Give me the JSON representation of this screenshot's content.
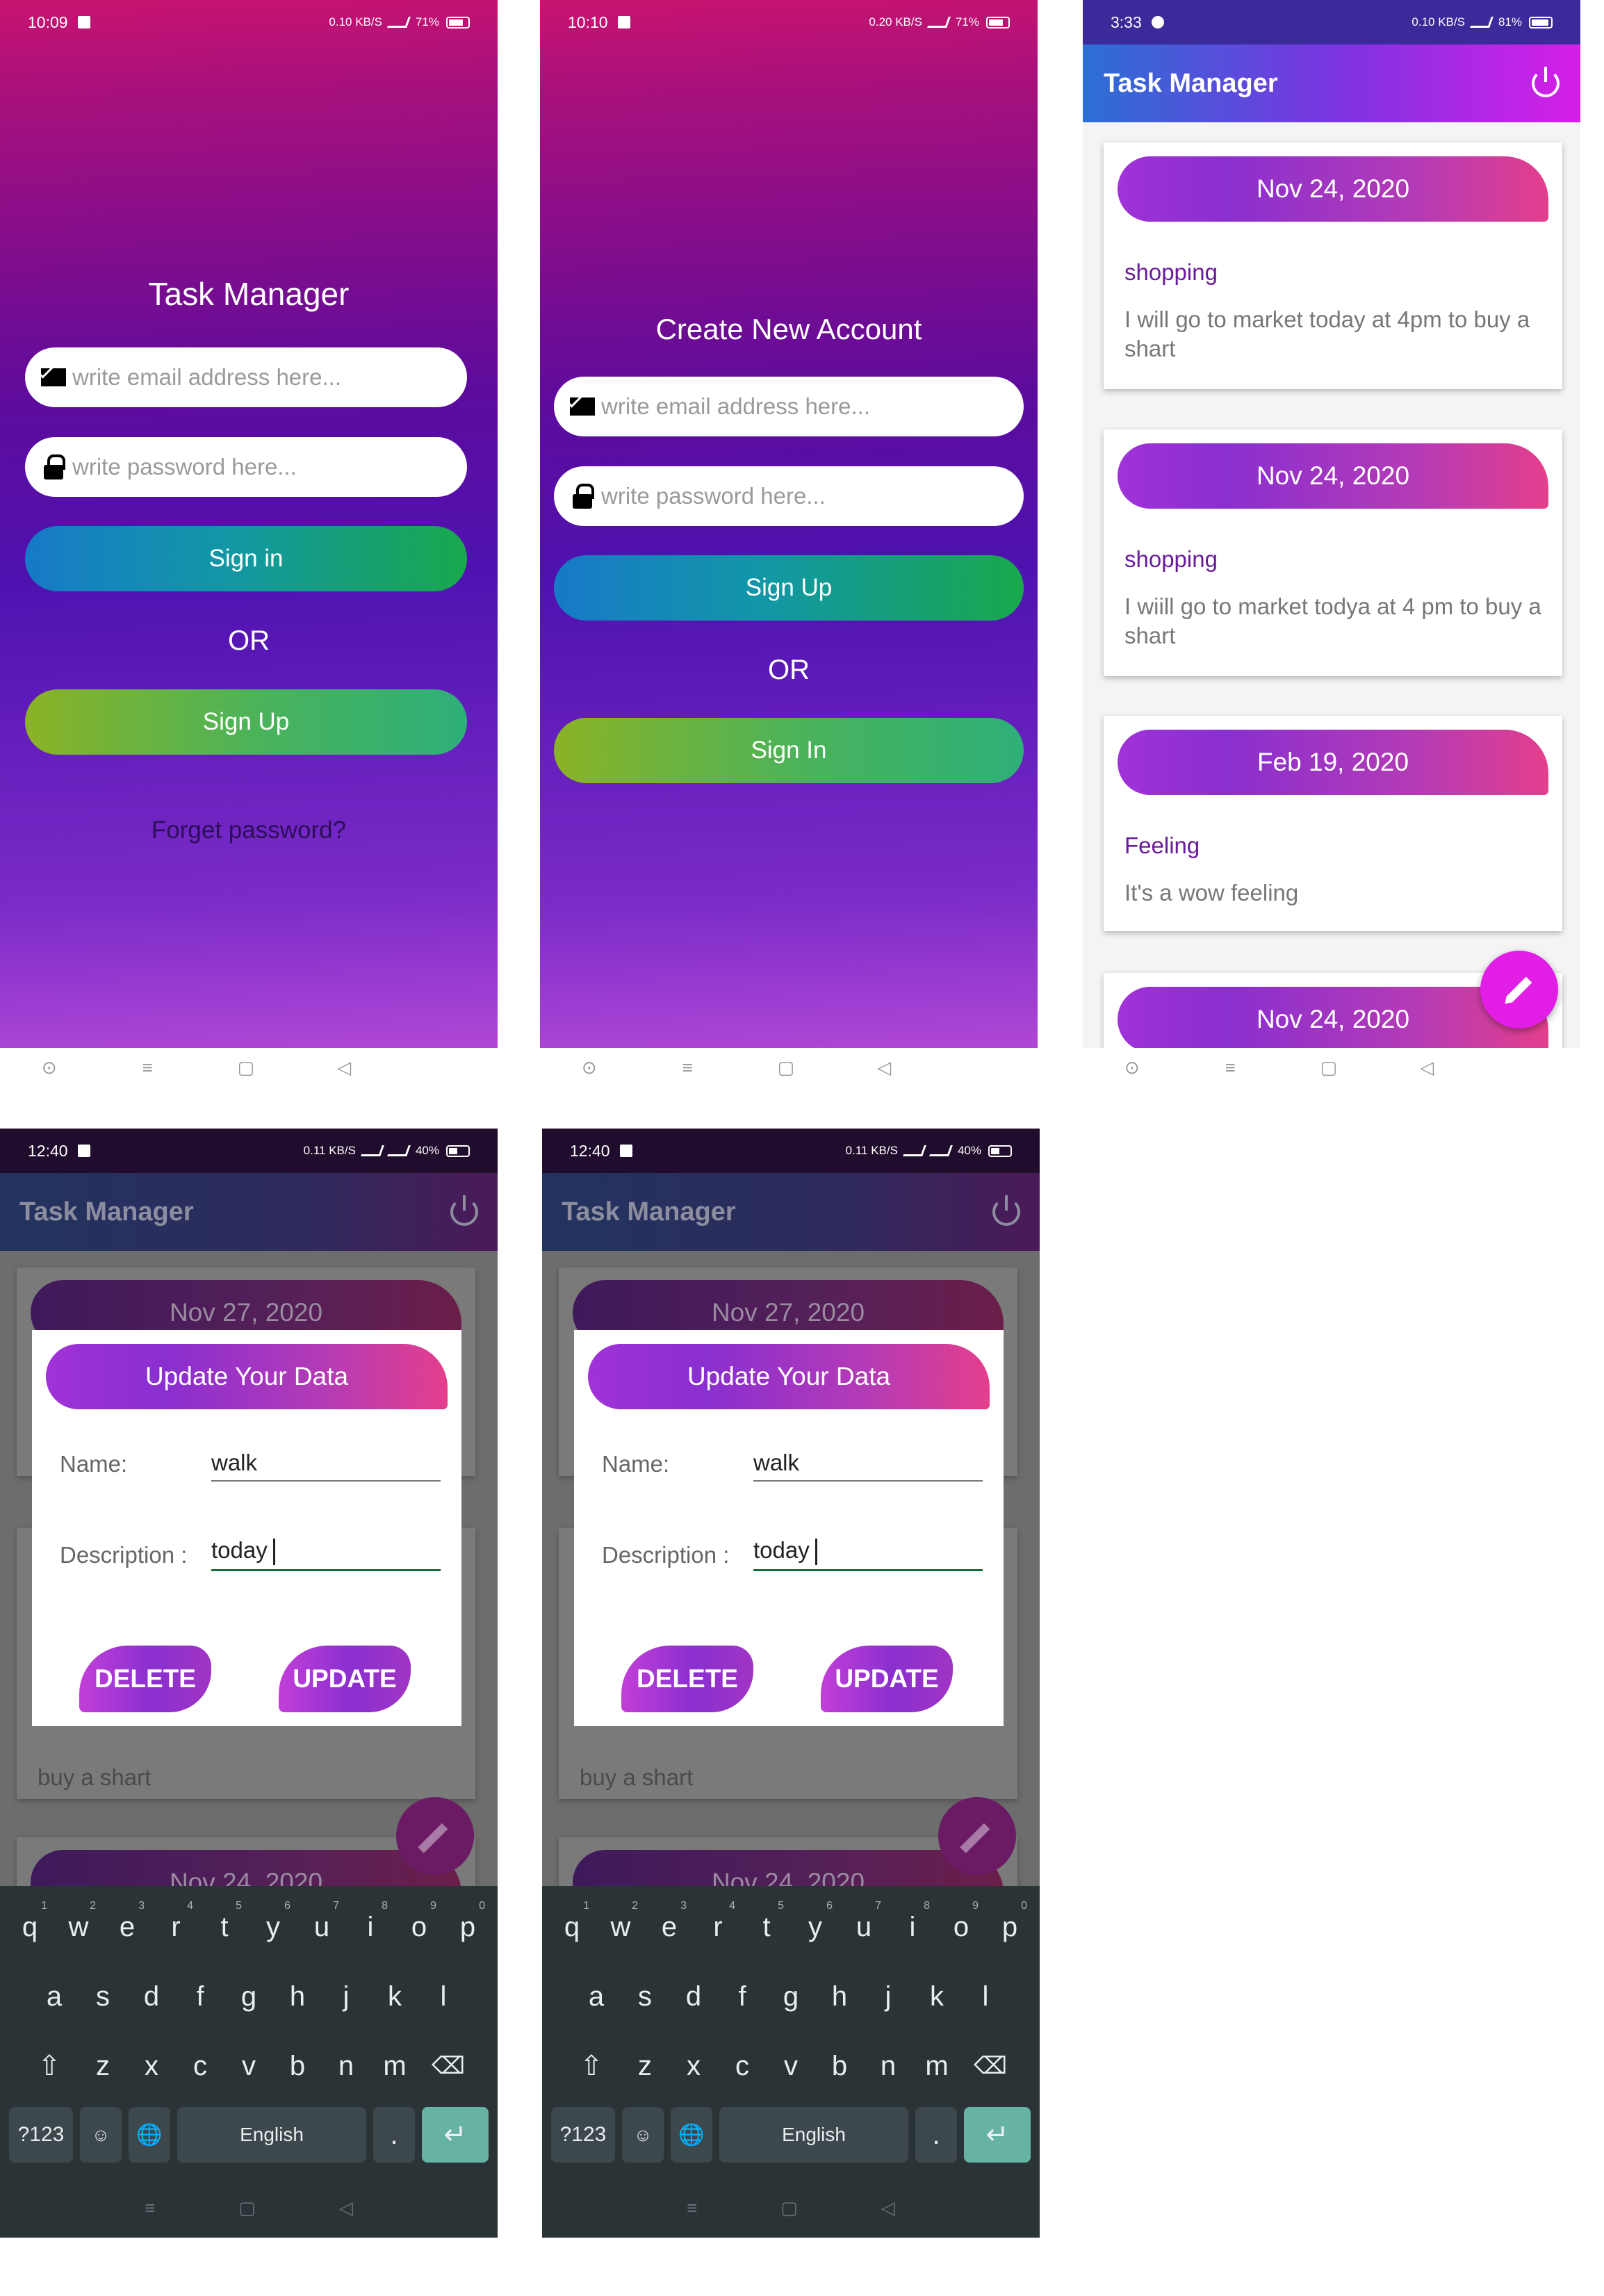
{
  "screen1": {
    "status_time": "10:09",
    "status_info": "0.10 KB/S",
    "battery": "71%",
    "title": "Task Manager",
    "email_placeholder": "write email address here...",
    "password_placeholder": "write password here...",
    "primary_button": "Sign in",
    "or_text": "OR",
    "secondary_button": "Sign Up",
    "forget_link": "Forget password?"
  },
  "screen2": {
    "status_time": "10:10",
    "status_info": "0.20 KB/S",
    "battery": "71%",
    "title": "Create New Account",
    "email_placeholder": "write email address here...",
    "password_placeholder": "write password here...",
    "primary_button": "Sign Up",
    "or_text": "OR",
    "secondary_button": "Sign In"
  },
  "screen3": {
    "status_time": "3:33",
    "status_info": "0.10 KB/S",
    "battery": "81%",
    "app_title": "Task Manager",
    "tasks": [
      {
        "date": "Nov 24, 2020",
        "name": "shopping",
        "description": "I will go to market today at 4pm to buy a shart"
      },
      {
        "date": "Nov 24, 2020",
        "name": "shopping",
        "description": "I wiill go to market todya at 4 pm to buy a shart"
      },
      {
        "date": "Feb 19, 2020",
        "name": "Feeling",
        "description": "It's a wow feeling"
      },
      {
        "date": "Nov 24, 2020",
        "name": "",
        "description": ""
      }
    ]
  },
  "screen4": {
    "status_time": "12:40",
    "status_info": "0.11 KB/S",
    "battery": "40%",
    "app_title": "Task Manager",
    "bg_card1_date": "Nov 27, 2020",
    "bg_card2_text": "buy a shart",
    "bg_card3_date": "Nov 24, 2020",
    "dialog": {
      "title": "Update Your Data",
      "name_label": "Name:",
      "name_value": "walk",
      "description_label": "Description :",
      "description_value": "today",
      "delete_button": "DELETE",
      "update_button": "UPDATE"
    }
  },
  "screen5": {
    "status_time": "12:40",
    "status_info": "0.11 KB/S",
    "battery": "40%",
    "app_title": "Task Manager",
    "bg_card1_date": "Nov 27, 2020",
    "bg_card2_text": "buy a shart",
    "bg_card3_date": "Nov 24, 2020",
    "dialog": {
      "title": "Update Your Data",
      "name_label": "Name:",
      "name_value": "walk",
      "description_label": "Description :",
      "description_value": "today",
      "delete_button": "DELETE",
      "update_button": "UPDATE"
    }
  },
  "keyboard": {
    "row1": [
      {
        "k": "q",
        "n": "1"
      },
      {
        "k": "w",
        "n": "2"
      },
      {
        "k": "e",
        "n": "3"
      },
      {
        "k": "r",
        "n": "4"
      },
      {
        "k": "t",
        "n": "5"
      },
      {
        "k": "y",
        "n": "6"
      },
      {
        "k": "u",
        "n": "7"
      },
      {
        "k": "i",
        "n": "8"
      },
      {
        "k": "o",
        "n": "9"
      },
      {
        "k": "p",
        "n": "0"
      }
    ],
    "row2": [
      "a",
      "s",
      "d",
      "f",
      "g",
      "h",
      "j",
      "k",
      "l"
    ],
    "row3": [
      "z",
      "x",
      "c",
      "v",
      "b",
      "n",
      "m"
    ],
    "symbols_key": "?123",
    "space_label": "English",
    "period_key": "."
  },
  "colors": {
    "accent": "#e21ee6",
    "title_purple": "#6a1b9a",
    "enter_key": "#66b2a3"
  }
}
